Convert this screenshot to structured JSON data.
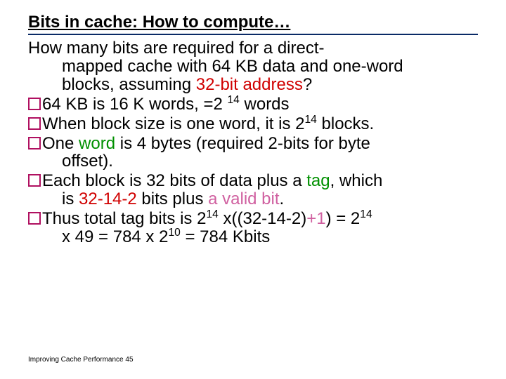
{
  "title": "Bits in cache: How to compute…",
  "q1": {
    "a": "How many bits are required for a direct-",
    "b": "mapped cache with 64 KB data and one-word",
    "c1": "blocks, assuming ",
    "c2": "32-bit address",
    "c3": "?"
  },
  "b1": {
    "a": "64 KB is 16 K words, =2 ",
    "exp1": "14",
    "b": " words"
  },
  "b2": {
    "a": "When block size is one word, it is  2",
    "exp1": "14",
    "b": " blocks."
  },
  "b3": {
    "a": "One ",
    "b": "word",
    "c": " is 4 bytes (required 2-bits for byte",
    "d": "offset)."
  },
  "b4": {
    "a": "Each block is 32 bits of data plus a ",
    "b": "tag",
    "c": ", which",
    "d": "is ",
    "e": "32-14-2",
    "f": " bits plus ",
    "g": "a valid bit",
    "h": "."
  },
  "b5": {
    "a": "Thus  total tag bits  is  2",
    "exp1": "14",
    "b": " x((32-14-2)",
    "c": "+1",
    "d": ") = 2",
    "exp2": "14",
    "e": "x 49 = 784 x 2",
    "exp3": "10",
    "f": " = 784 Kbits"
  },
  "footer": "Improving Cache Performance 45"
}
